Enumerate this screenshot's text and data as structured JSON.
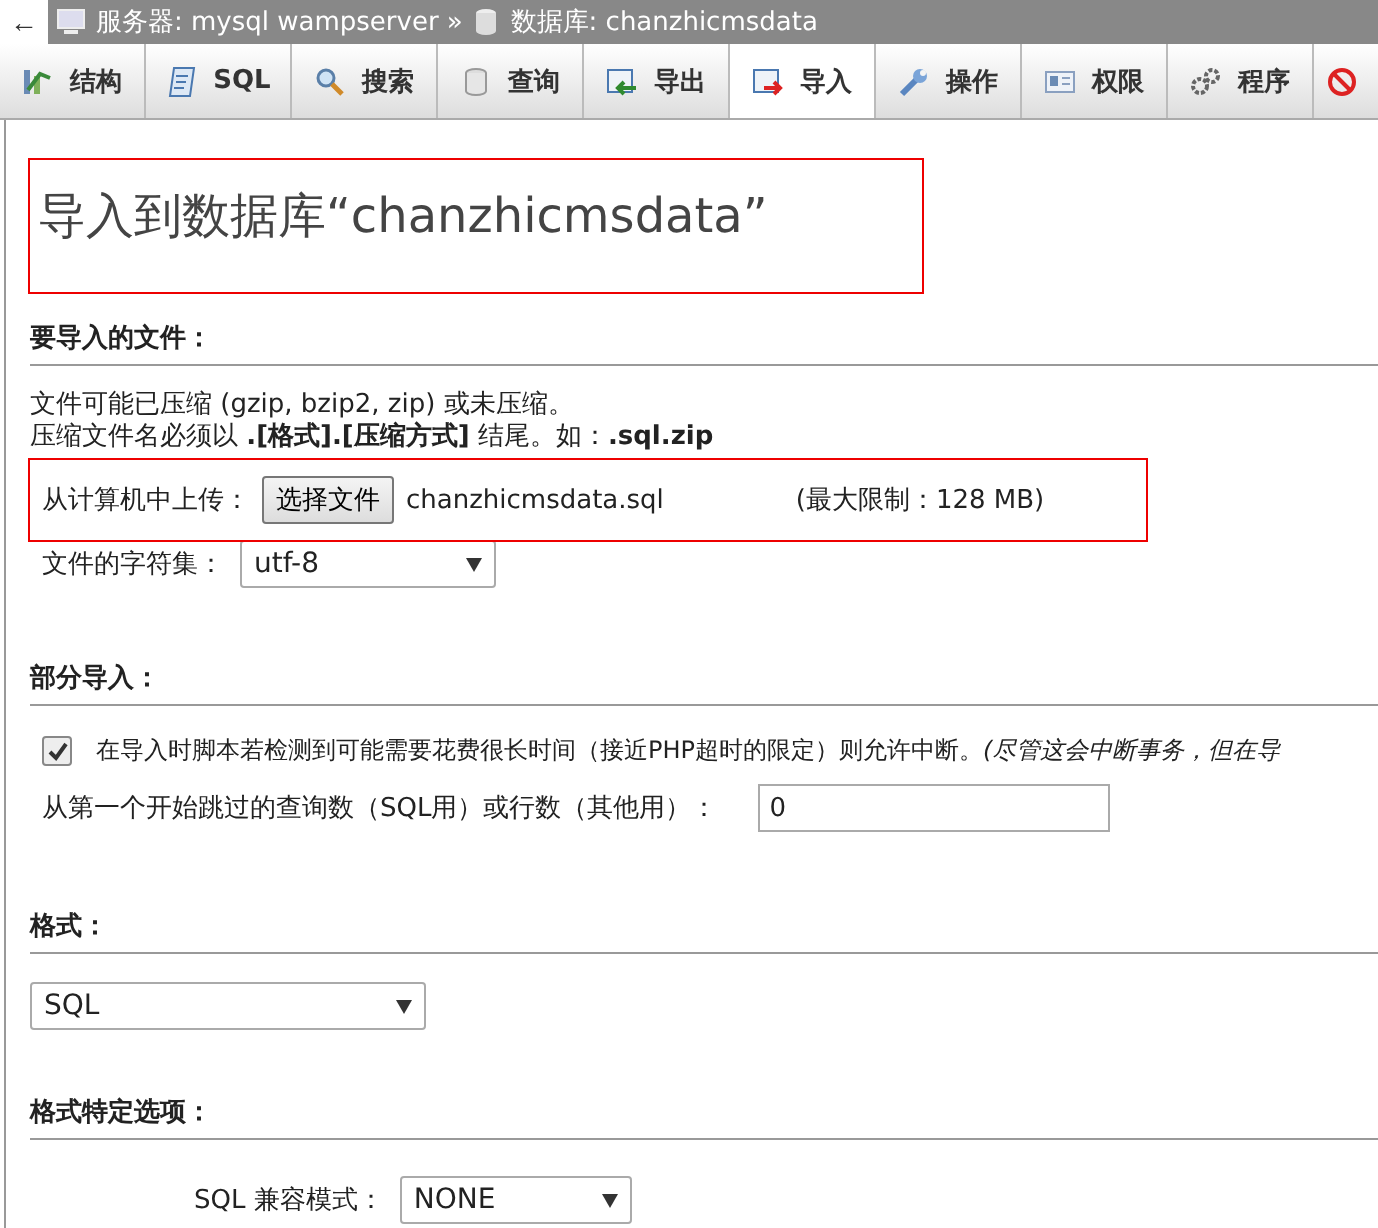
{
  "breadcrumb": {
    "back": "←",
    "server_label": "服务器: mysql wampserver",
    "separator": "»",
    "database_label": "数据库: chanzhicmsdata"
  },
  "tabs": [
    {
      "label": "结构",
      "selected": false
    },
    {
      "label": "SQL",
      "selected": false
    },
    {
      "label": "搜索",
      "selected": false
    },
    {
      "label": "查询",
      "selected": false
    },
    {
      "label": "导出",
      "selected": false
    },
    {
      "label": "导入",
      "selected": true
    },
    {
      "label": "操作",
      "selected": false
    },
    {
      "label": "权限",
      "selected": false
    },
    {
      "label": "程序",
      "selected": false
    }
  ],
  "title": {
    "text": "导入到数据库“chanzhicmsdata”",
    "highlighted": true
  },
  "file_section": {
    "heading": "要导入的文件：",
    "note_1": "文件可能已压缩 (gzip, bzip2, zip) 或未压缩。",
    "note_2": "压缩文件名必须以 **.[格式].[压缩方式]** 结尾。如：**.sql.zip**",
    "upload": {
      "label": "从计算机中上传：",
      "button": "选择文件",
      "file_name": "chanzhicmsdata.sql",
      "limit": "(最大限制：128 MB)",
      "highlighted": true
    },
    "charset": {
      "label": "文件的字符集：",
      "value": "utf-8"
    }
  },
  "partial_section": {
    "heading": "部分导入：",
    "allow_interrupt": {
      "checked": true,
      "text": "在导入时脚本若检测到可能需要花费很长时间（接近PHP超时的限定）则允许中断。",
      "note": "(尽管这会中断事务，但在导"
    },
    "skip": {
      "label": "从第一个开始跳过的查询数（SQL用）或行数（其他用）：",
      "value": "0"
    }
  },
  "format_section": {
    "heading": "格式：",
    "value": "SQL"
  },
  "options_section": {
    "heading": "格式特定选项：",
    "compat": {
      "label": "SQL 兼容模式：",
      "value": "NONE"
    }
  }
}
